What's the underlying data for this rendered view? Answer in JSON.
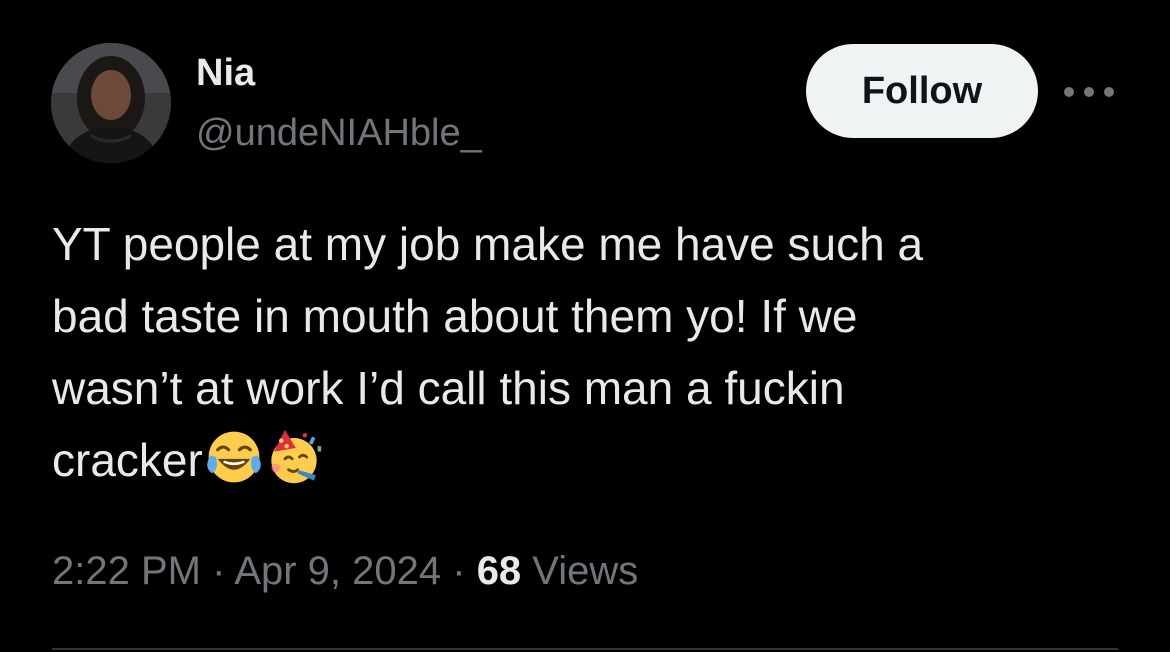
{
  "author": {
    "display_name": "Nia",
    "handle": "@undeNIAHble_",
    "avatar_icon": "profile-photo"
  },
  "actions": {
    "follow_label": "Follow",
    "more_icon": "more-horizontal-icon"
  },
  "tweet": {
    "lines": [
      "YT people at my job make me have such a",
      "bad taste in mouth about them yo! If we",
      "wasn’t at work I’d call this man a fuckin",
      "cracker"
    ],
    "emojis": [
      "face-with-tears-of-joy",
      "partying-face"
    ]
  },
  "meta": {
    "time": "2:22 PM",
    "separator": " · ",
    "date": "Apr 9, 2024",
    "views_count": "68",
    "views_label": " Views"
  },
  "colors": {
    "background": "#000000",
    "primary_text": "#e7e9ea",
    "secondary_text": "#71767b",
    "follow_bg": "#eff3f4",
    "follow_text": "#0f1419"
  }
}
